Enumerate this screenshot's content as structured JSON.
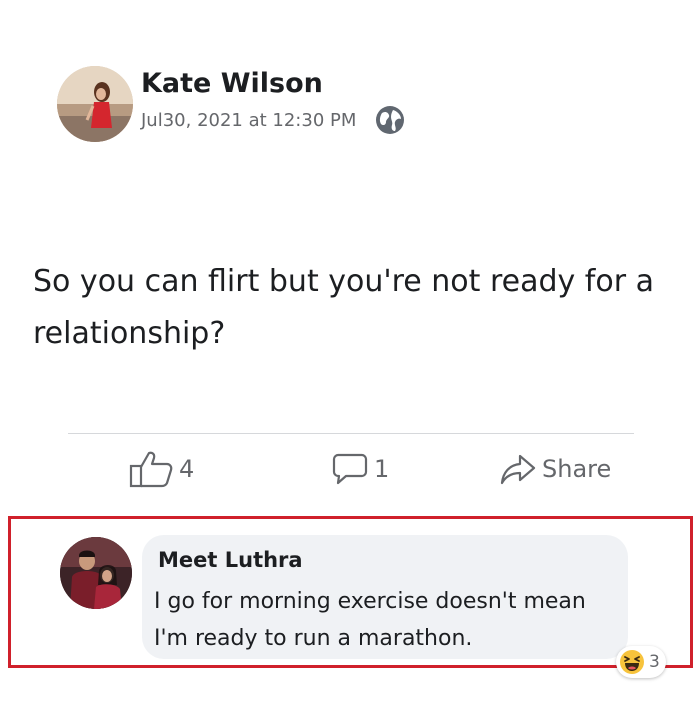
{
  "post": {
    "author": "Kate Wilson",
    "date": "Jul30, 2021 at 12:30 PM",
    "privacy_icon": "globe-icon",
    "text": "So you can flirt but you're not ready for a relationship?",
    "likes": "4",
    "comments": "1",
    "share_label": "Share"
  },
  "comment": {
    "author": "Meet Luthra",
    "text": "I go for morning exercise doesn't mean I'm ready to run a marathon.",
    "reaction_icon": "laughing-face-icon",
    "reaction_count": "3"
  },
  "colors": {
    "text": "#1c1e21",
    "muted": "#65676b",
    "bubble": "#f0f2f5",
    "highlight_border": "#d0202b"
  }
}
